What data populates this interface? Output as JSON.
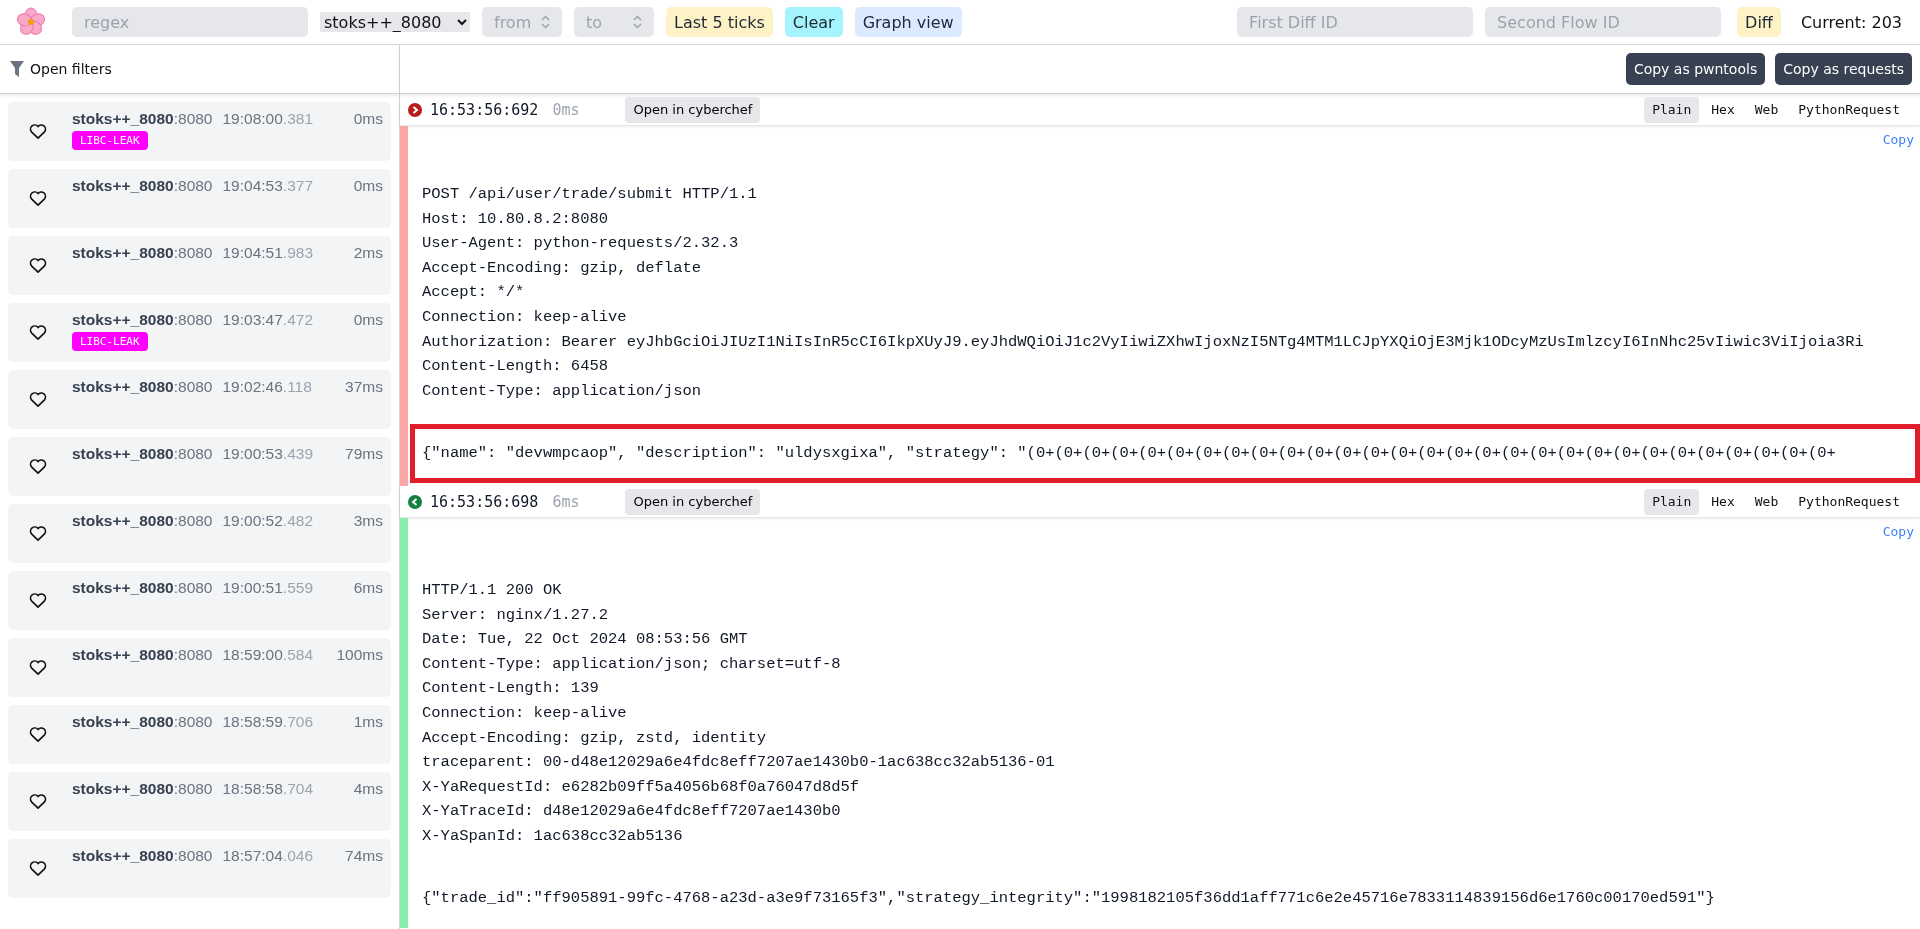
{
  "topbar": {
    "search": {
      "placeholder": "regex"
    },
    "service_select": {
      "value": "stoks++_8080"
    },
    "from": {
      "placeholder": "from"
    },
    "to": {
      "placeholder": "to"
    },
    "buttons": [
      {
        "label": "Last 5 ticks",
        "kind": "ticks"
      },
      {
        "label": "Clear",
        "kind": "clear"
      },
      {
        "label": "Graph view",
        "kind": "graph"
      }
    ],
    "diff": {
      "first": {
        "placeholder": "First Diff ID"
      },
      "second": {
        "placeholder": "Second Flow ID"
      },
      "button": "Diff"
    },
    "current": "Current: 203"
  },
  "filters": {
    "label": "Open filters"
  },
  "copy_buttons": [
    "Copy as pwntools",
    "Copy as requests"
  ],
  "flows": [
    {
      "service": "stoks++_8080",
      "port": ":8080",
      "time": "19:08:00",
      "millis": ".381",
      "duration": "0ms",
      "starred": false,
      "tags": [
        "LIBC-LEAK"
      ]
    },
    {
      "service": "stoks++_8080",
      "port": ":8080",
      "time": "19:04:53",
      "millis": ".377",
      "duration": "0ms",
      "starred": false
    },
    {
      "service": "stoks++_8080",
      "port": ":8080",
      "time": "19:04:51",
      "millis": ".983",
      "duration": "2ms",
      "starred": false
    },
    {
      "service": "stoks++_8080",
      "port": ":8080",
      "time": "19:03:47",
      "millis": ".472",
      "duration": "0ms",
      "starred": false,
      "tags": [
        "LIBC-LEAK"
      ]
    },
    {
      "service": "stoks++_8080",
      "port": ":8080",
      "time": "19:02:46",
      "millis": ".118",
      "duration": "37ms",
      "starred": false
    },
    {
      "service": "stoks++_8080",
      "port": ":8080",
      "time": "19:00:53",
      "millis": ".439",
      "duration": "79ms",
      "starred": false
    },
    {
      "service": "stoks++_8080",
      "port": ":8080",
      "time": "19:00:52",
      "millis": ".482",
      "duration": "3ms",
      "starred": false
    },
    {
      "service": "stoks++_8080",
      "port": ":8080",
      "time": "19:00:51",
      "millis": ".559",
      "duration": "6ms",
      "starred": false
    },
    {
      "service": "stoks++_8080",
      "port": ":8080",
      "time": "18:59:00",
      "millis": ".584",
      "duration": "100ms",
      "starred": false
    },
    {
      "service": "stoks++_8080",
      "port": ":8080",
      "time": "18:58:59",
      "millis": ".706",
      "duration": "1ms",
      "starred": false
    },
    {
      "service": "stoks++_8080",
      "port": ":8080",
      "time": "18:58:58",
      "millis": ".704",
      "duration": "4ms",
      "starred": false
    },
    {
      "service": "stoks++_8080",
      "port": ":8080",
      "time": "18:57:04",
      "millis": ".046",
      "duration": "74ms",
      "starred": false
    }
  ],
  "messages": [
    {
      "kind": "request",
      "time": "16:53:56:692",
      "delta": "0ms",
      "cyberchef": "Open in cyberchef",
      "copy": "Copy",
      "highlighted": true,
      "views": [
        {
          "label": "Plain",
          "selected": true
        },
        {
          "label": "Hex",
          "selected": false
        },
        {
          "label": "Web",
          "selected": false
        },
        {
          "label": "PythonRequest",
          "selected": false
        }
      ],
      "headers": [
        "POST /api/user/trade/submit HTTP/1.1",
        "Host: 10.80.8.2:8080",
        "User-Agent: python-requests/2.32.3",
        "Accept-Encoding: gzip, deflate",
        "Accept: */*",
        "Connection: keep-alive",
        "Authorization: Bearer eyJhbGciOiJIUzI1NiIsInR5cCI6IkpXUyJ9.eyJhdWQiOiJ1c2VyIiwiZXhwIjoxNzI5NTg4MTM1LCJpYXQiOjE3Mjk1ODcyMzUsImlzcyI6InNhc25vIiwic3ViIjoia3Ri",
        "Content-Length: 6458",
        "Content-Type: application/json"
      ],
      "body": "{\"name\": \"devwmpcaop\", \"description\": \"uldysxgixa\", \"strategy\": \"(0+(0+(0+(0+(0+(0+(0+(0+(0+(0+(0+(0+(0+(0+(0+(0+(0+(0+(0+(0+(0+(0+(0+(0+(0+(0+(0+(0+(0+"
    },
    {
      "kind": "response",
      "time": "16:53:56:698",
      "delta": "6ms",
      "cyberchef": "Open in cyberchef",
      "copy": "Copy",
      "highlighted": false,
      "views": [
        {
          "label": "Plain",
          "selected": true
        },
        {
          "label": "Hex",
          "selected": false
        },
        {
          "label": "Web",
          "selected": false
        },
        {
          "label": "PythonRequest",
          "selected": false
        }
      ],
      "headers": [
        "HTTP/1.1 200 OK",
        "Server: nginx/1.27.2",
        "Date: Tue, 22 Oct 2024 08:53:56 GMT",
        "Content-Type: application/json; charset=utf-8",
        "Content-Length: 139",
        "Connection: keep-alive",
        "Accept-Encoding: gzip, zstd, identity",
        "traceparent: 00-d48e12029a6e4fdc8eff7207ae1430b0-1ac638cc32ab5136-01",
        "X-YaRequestId: e6282b09ff5a4056b68f0a76047d8d5f",
        "X-YaTraceId: d48e12029a6e4fdc8eff7207ae1430b0",
        "X-YaSpanId: 1ac638cc32ab5136"
      ],
      "body": "{\"trade_id\":\"ff905891-99fc-4768-a23d-a3e9f73165f3\",\"strategy_integrity\":\"1998182105f36dd1aff771c6e2e45716e7833114839156d6e1760c00170ed591\"}"
    }
  ]
}
